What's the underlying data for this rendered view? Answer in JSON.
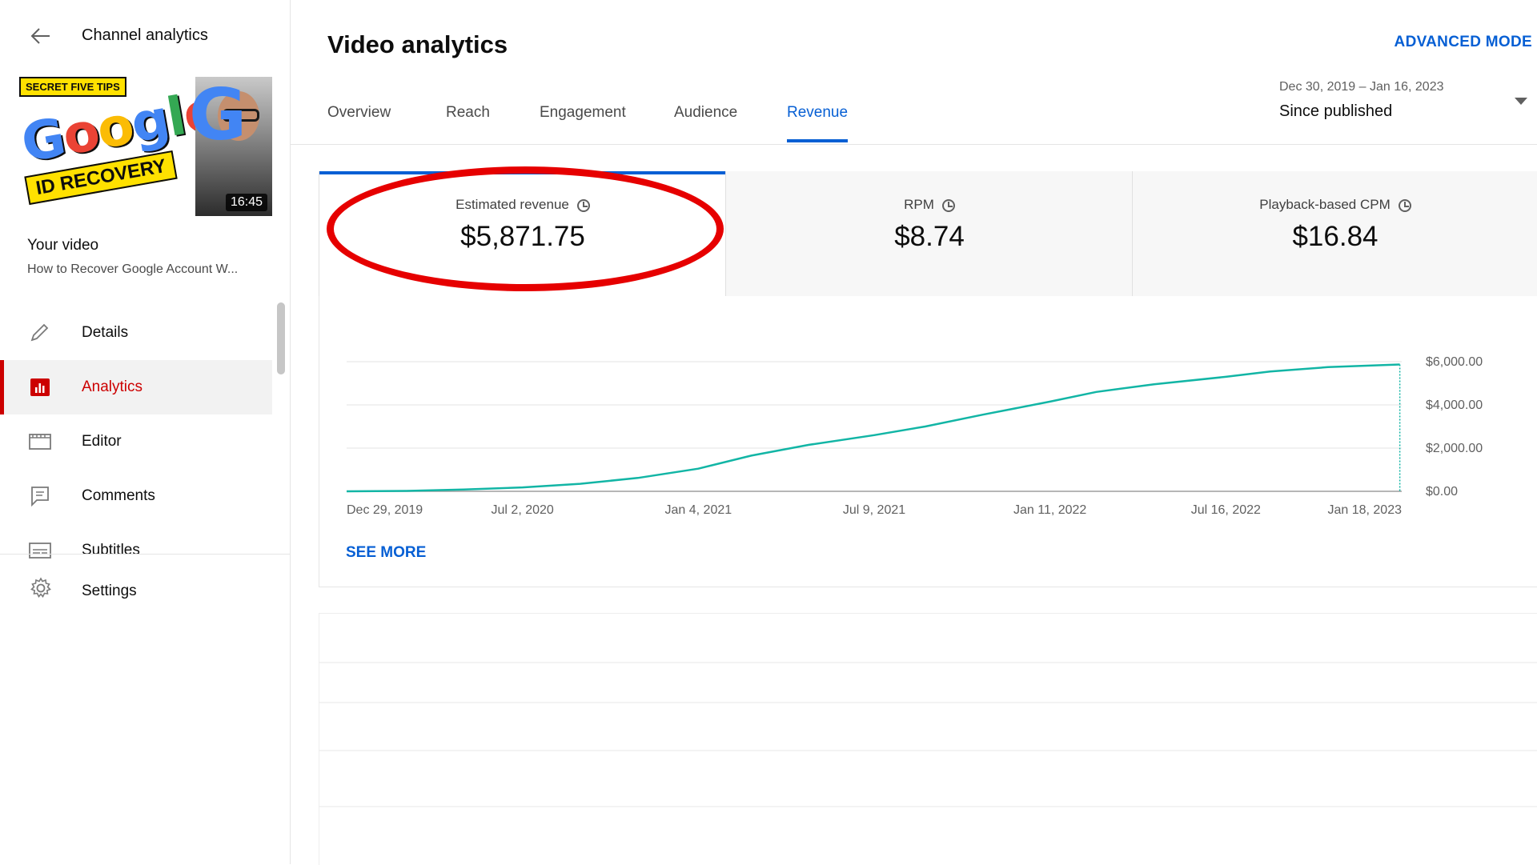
{
  "sidebar": {
    "header_title": "Channel analytics",
    "thumbnail": {
      "tag": "SECRET FIVE TIPS",
      "logo_letters": [
        "G",
        "o",
        "o",
        "g",
        "l",
        "e"
      ],
      "logo_colors": [
        "#4285f4",
        "#ea4335",
        "#fbbc05",
        "#4285f4",
        "#34a853",
        "#ea4335"
      ],
      "subtitle": "ID RECOVERY",
      "big_letter": "G",
      "duration": "16:45"
    },
    "your_video_label": "Your video",
    "video_title": "How to Recover Google Account W...",
    "nav_items": [
      {
        "label": "Details",
        "icon": "pencil-icon",
        "active": false
      },
      {
        "label": "Analytics",
        "icon": "analytics-icon",
        "active": true
      },
      {
        "label": "Editor",
        "icon": "editor-icon",
        "active": false
      },
      {
        "label": "Comments",
        "icon": "comments-icon",
        "active": false
      },
      {
        "label": "Subtitles",
        "icon": "subtitles-icon",
        "active": false
      }
    ],
    "settings_label": "Settings"
  },
  "main": {
    "title": "Video analytics",
    "advanced_mode": "ADVANCED MODE",
    "tabs": [
      "Overview",
      "Reach",
      "Engagement",
      "Audience",
      "Revenue"
    ],
    "active_tab": "Revenue",
    "date_range": "Dec 30, 2019 – Jan 16, 2023",
    "date_label": "Since published",
    "metrics": [
      {
        "label": "Estimated revenue",
        "value": "$5,871.75"
      },
      {
        "label": "RPM",
        "value": "$8.74"
      },
      {
        "label": "Playback-based CPM",
        "value": "$16.84"
      }
    ],
    "see_more": "SEE MORE"
  },
  "colors": {
    "accent_blue": "#065fd4",
    "active_red": "#cc0000",
    "line_teal": "#12b5a5",
    "highlight_red": "#e60000"
  },
  "chart_data": {
    "type": "line",
    "x_tick_labels": [
      "Dec 29, 2019",
      "Jul 2, 2020",
      "Jan 4, 2021",
      "Jul 9, 2021",
      "Jan 11, 2022",
      "Jul 16, 2022",
      "Jan 18, 2023"
    ],
    "y_tick_labels": [
      "$6,000.00",
      "$4,000.00",
      "$2,000.00",
      "$0.00"
    ],
    "ylim": [
      0,
      6000
    ],
    "x_dates": [
      "Dec 29, 2019",
      "Mar 1, 2020",
      "May 1, 2020",
      "Jul 2, 2020",
      "Sep 1, 2020",
      "Nov 1, 2020",
      "Jan 4, 2021",
      "Mar 1, 2021",
      "May 1, 2021",
      "Jul 9, 2021",
      "Sep 1, 2021",
      "Nov 1, 2021",
      "Jan 11, 2022",
      "Mar 1, 2022",
      "May 1, 2022",
      "Jul 16, 2022",
      "Sep 1, 2022",
      "Nov 1, 2022",
      "Jan 16, 2023"
    ],
    "y": [
      0,
      20,
      80,
      180,
      350,
      620,
      1050,
      1650,
      2150,
      2600,
      3000,
      3550,
      4150,
      4600,
      4950,
      5300,
      5550,
      5750,
      5871.75
    ],
    "grid": true,
    "y_axis_position": "right"
  }
}
